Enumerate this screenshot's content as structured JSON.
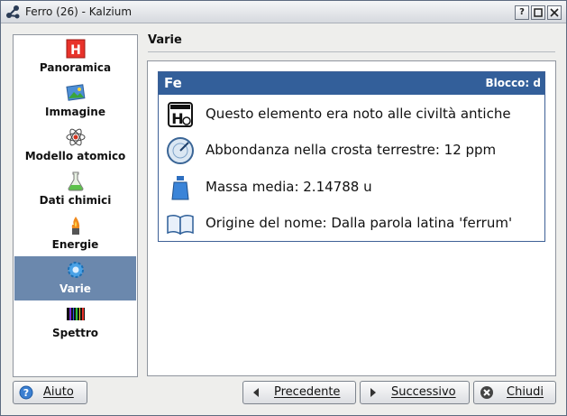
{
  "window": {
    "title": "Ferro (26) - Kalzium"
  },
  "sidebar": {
    "items": [
      {
        "label": "Panoramica",
        "icon": "periodic-element-icon"
      },
      {
        "label": "Immagine",
        "icon": "picture-icon"
      },
      {
        "label": "Modello atomico",
        "icon": "atom-model-icon"
      },
      {
        "label": "Dati chimici",
        "icon": "flask-icon"
      },
      {
        "label": "Energie",
        "icon": "flame-icon"
      },
      {
        "label": "Varie",
        "icon": "gear-icon"
      },
      {
        "label": "Spettro",
        "icon": "spectrum-icon"
      }
    ],
    "selected": "Varie"
  },
  "page": {
    "title": "Varie"
  },
  "element_card": {
    "symbol": "Fe",
    "block": "Blocco: d",
    "rows": [
      {
        "icon": "history-element-icon",
        "text": "Questo elemento era noto alle civiltà antiche"
      },
      {
        "icon": "radar-icon",
        "text": "Abbondanza nella crosta terrestre: 12 ppm"
      },
      {
        "icon": "weight-icon",
        "text": "Massa media: 2.14788 u"
      },
      {
        "icon": "book-icon",
        "text": "Origine del nome: Dalla parola latina 'ferrum'"
      }
    ]
  },
  "buttons": {
    "help": "Aiuto",
    "previous": "Precedente",
    "next": "Successivo",
    "close": "Chiudi"
  },
  "colors": {
    "selection": "#6b88ad",
    "card_header": "#335f9a"
  }
}
